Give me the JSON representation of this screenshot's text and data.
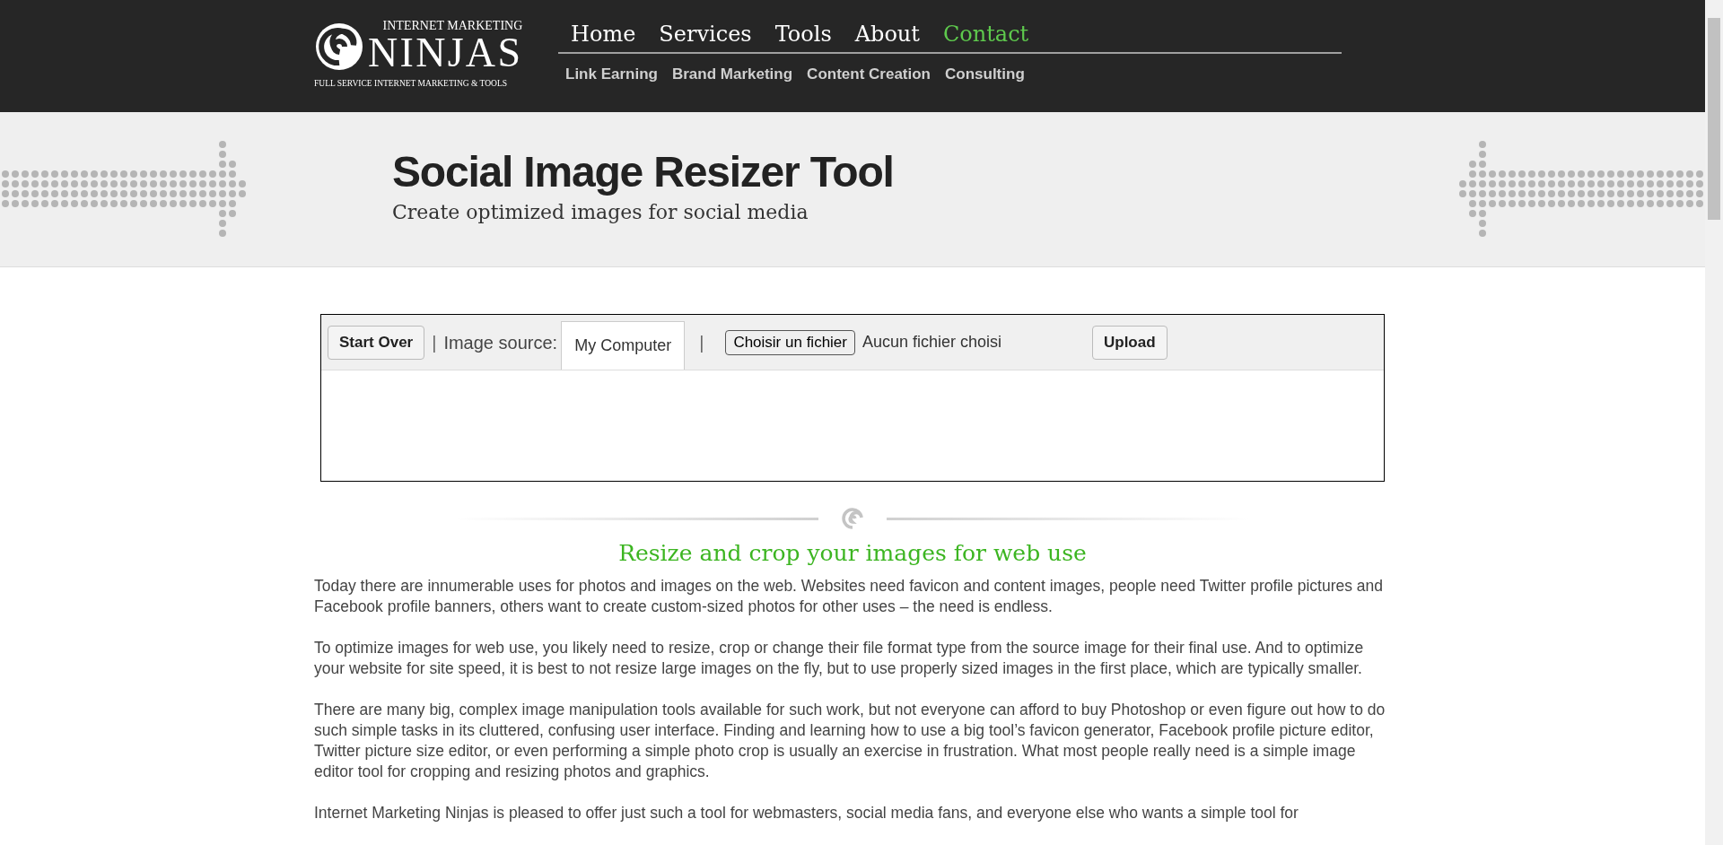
{
  "logo": {
    "top": "INTERNET MARKETING",
    "main": "NINJAS",
    "tagline": "FULL SERVICE INTERNET MARKETING & TOOLS"
  },
  "nav": [
    {
      "label": "Home",
      "selected": false
    },
    {
      "label": "Services",
      "selected": false
    },
    {
      "label": "Tools",
      "selected": false
    },
    {
      "label": "About",
      "selected": false
    },
    {
      "label": "Contact",
      "selected": true
    }
  ],
  "subnav": [
    "Link Earning",
    "Brand Marketing",
    "Content Creation",
    "Consulting"
  ],
  "banner": {
    "title": "Social Image Resizer Tool",
    "subtitle": "Create optimized images for social media"
  },
  "tool": {
    "start_over": "Start Over",
    "separator_1": "|",
    "source_label": "Image source:",
    "source_tab": "My Computer",
    "separator_2": "|",
    "file_button": "Choisir un fichier",
    "file_status": "Aucun fichier choisi",
    "upload": "Upload"
  },
  "heading": "Resize and crop your images for web use",
  "paragraphs": [
    "Today there are innumerable uses for photos and images on the web. Websites need favicon and content images, people need Twitter profile pictures and Facebook profile banners, others want to create custom-sized photos for other uses – the need is endless.",
    "To optimize images for web use, you likely need to resize, crop or change their file format type from the source image for their final use. And to optimize your website for site speed, it is best to not resize large images on the fly, but to use properly sized images in the first place, which are typically smaller.",
    "There are many big, complex image manipulation tools available for such work, but not everyone can afford to buy Photoshop or even figure out how to do such simple tasks in its cluttered, confusing user interface. Finding and learning how to use a big tool’s favicon generator, Facebook profile picture editor, Twitter picture size editor, or even performing a simple photo crop is usually an exercise in frustration. What most people really need is a simple image editor tool for cropping and resizing photos and graphics.",
    "Internet Marketing Ninjas is pleased to offer just such a tool for webmasters, social media fans, and everyone else who wants a simple tool for"
  ]
}
